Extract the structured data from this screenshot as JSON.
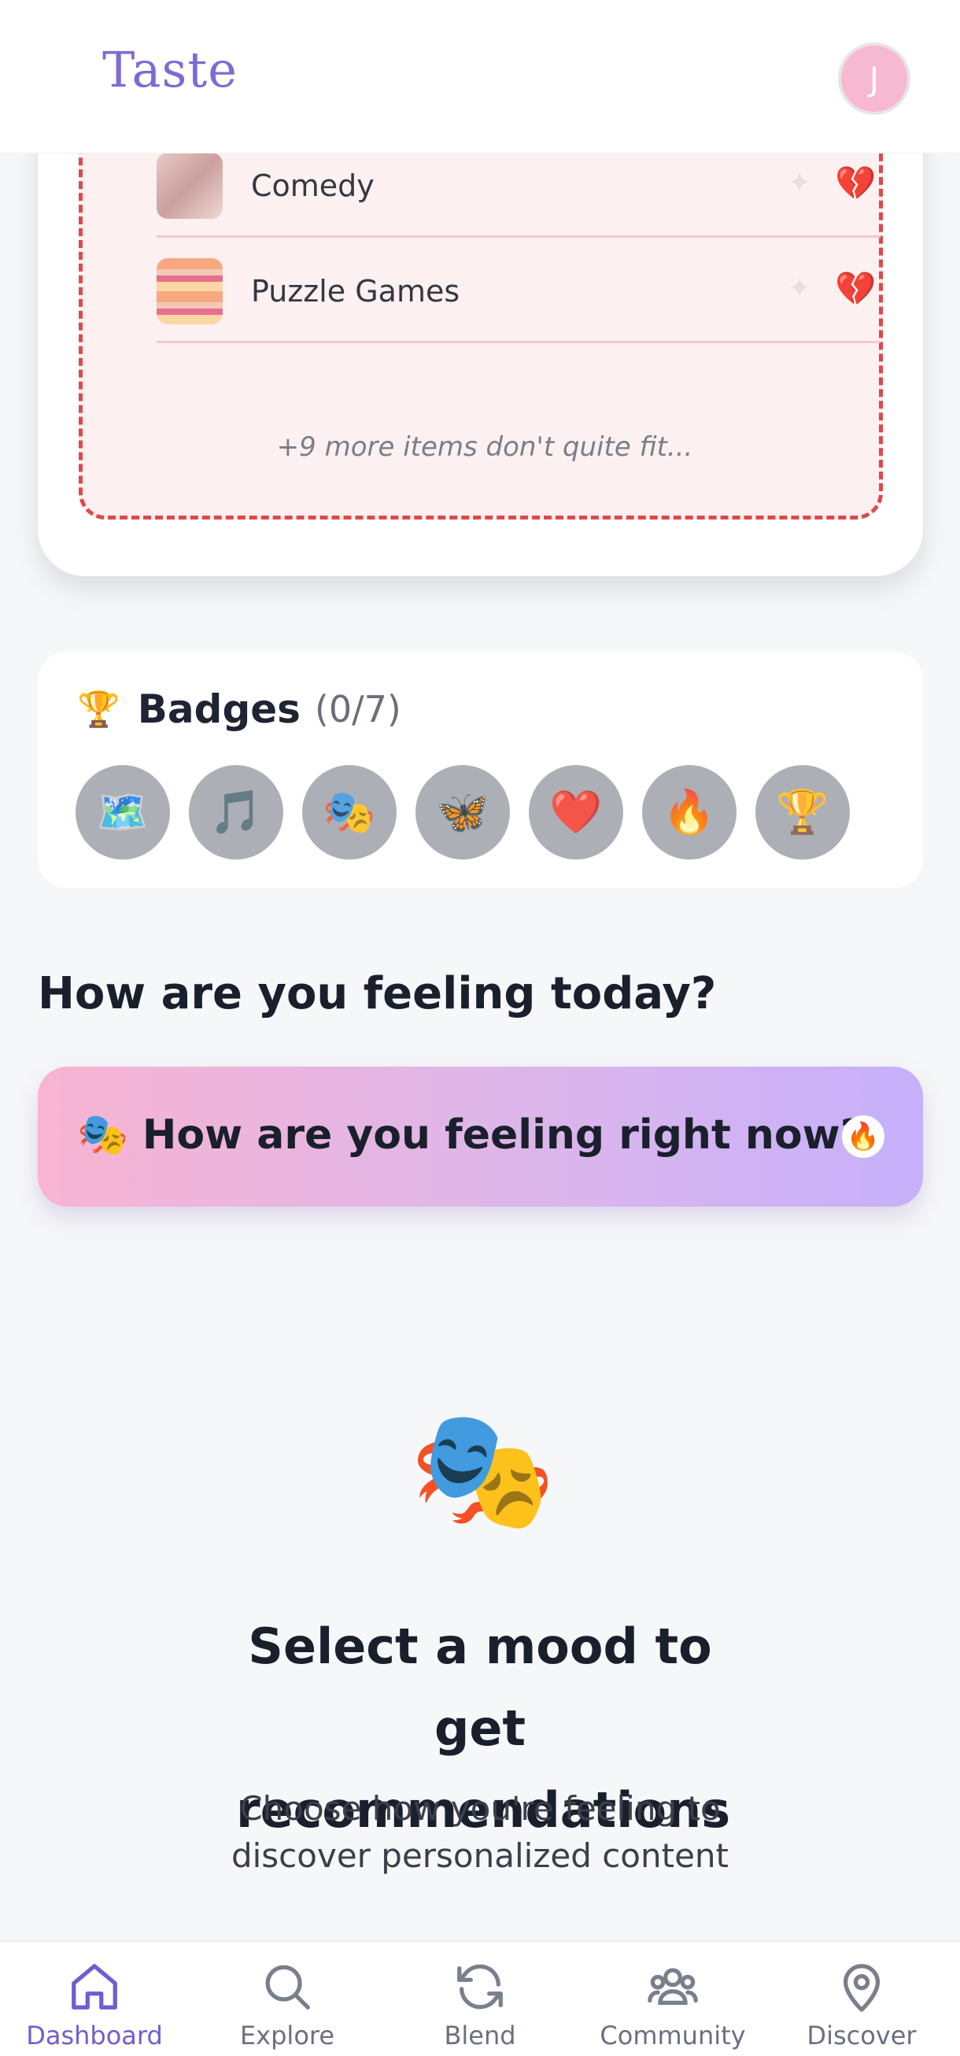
{
  "header": {
    "logo": "Taste",
    "avatar_initial": "J"
  },
  "dislikes": {
    "items": [
      {
        "label": ""
      },
      {
        "label": "Comedy"
      },
      {
        "label": "Puzzle Games"
      }
    ],
    "more_text": "+9 more items don't quite fit..."
  },
  "badges": {
    "title": "Badges",
    "count": "(0/7)",
    "items": [
      {
        "icon": "map-icon",
        "glyph": "🗺️"
      },
      {
        "icon": "music-note-icon",
        "glyph": "🎵"
      },
      {
        "icon": "theater-masks-icon",
        "glyph": "🎭"
      },
      {
        "icon": "butterfly-icon",
        "glyph": "🦋"
      },
      {
        "icon": "heart-icon",
        "glyph": "❤️"
      },
      {
        "icon": "fire-icon",
        "glyph": "🔥"
      },
      {
        "icon": "trophy-icon",
        "glyph": "🏆"
      }
    ]
  },
  "mood": {
    "heading": "How are you feeling today?",
    "prompt": "🎭 How are you feeling right now?",
    "empty_title": "Select a mood to get recommendations",
    "empty_subtitle": "Choose how you're feeling to discover personalized content"
  },
  "nav": {
    "items": [
      {
        "label": "Dashboard",
        "active": true
      },
      {
        "label": "Explore",
        "active": false
      },
      {
        "label": "Blend",
        "active": false
      },
      {
        "label": "Community",
        "active": false
      },
      {
        "label": "Discover",
        "active": false
      }
    ]
  },
  "colors": {
    "accent": "#7c6bd6",
    "danger": "#e04848",
    "avatar": "#f7b8d2"
  }
}
